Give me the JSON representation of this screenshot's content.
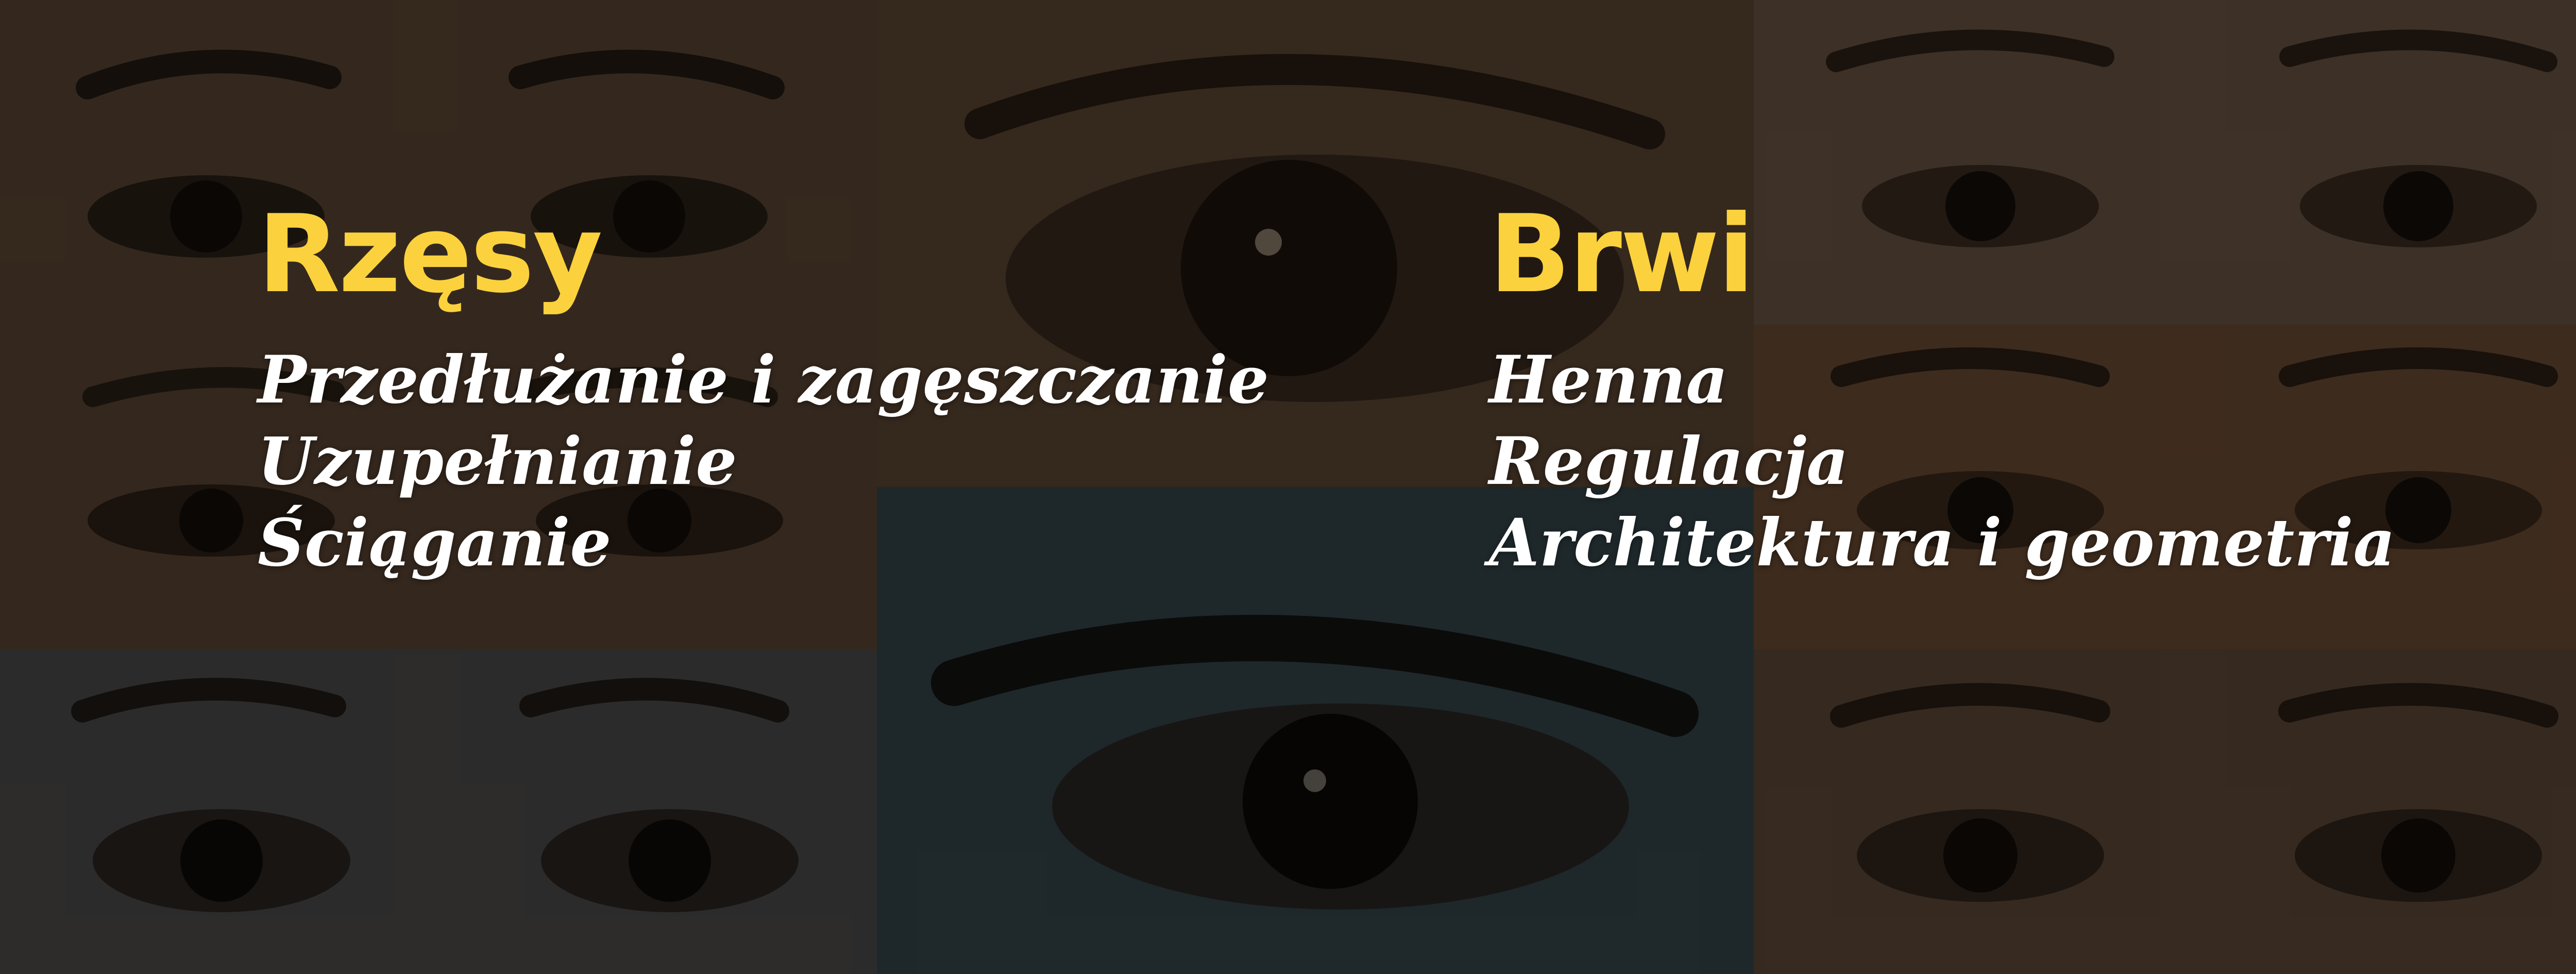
{
  "colors": {
    "accent": "#fbd23d",
    "text": "#ffffff",
    "background": "#17130f"
  },
  "sections": [
    {
      "heading": "Rzęsy",
      "items": [
        "Przedłużanie i zagęszczanie",
        "Uzupełnianie",
        "Ściąganie"
      ]
    },
    {
      "heading": "Brwi",
      "items": [
        "Henna",
        "Regulacja",
        "Architektura i geometria"
      ]
    }
  ]
}
